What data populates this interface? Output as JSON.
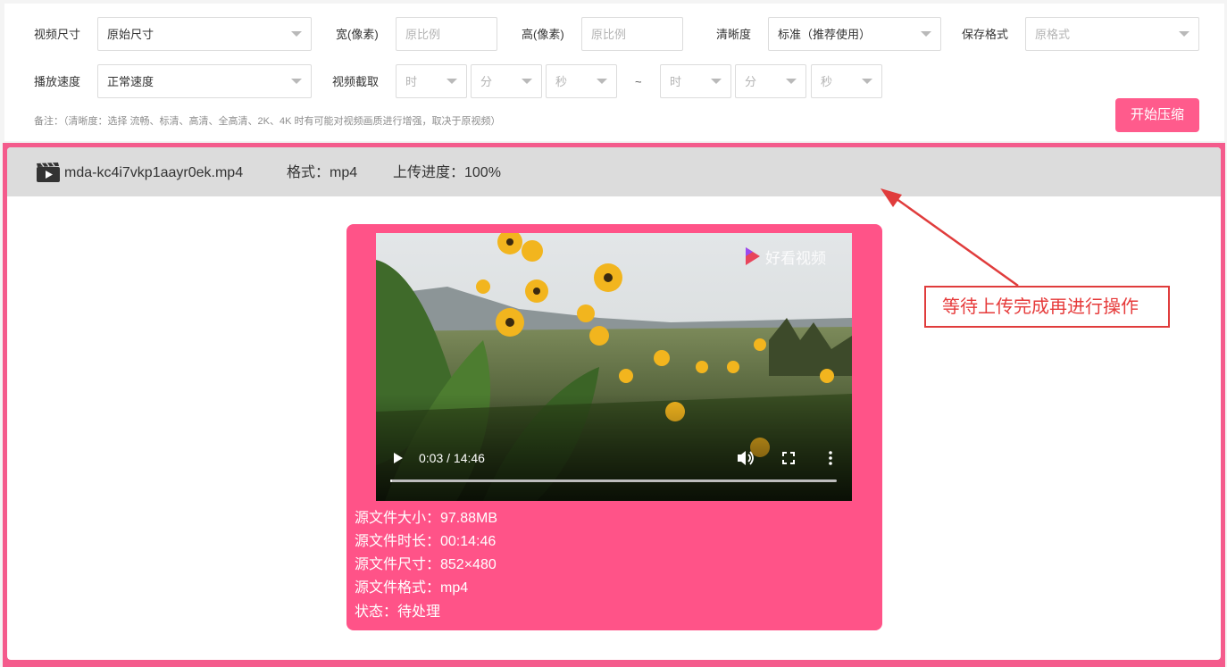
{
  "settings": {
    "video_size_label": "视频尺寸",
    "video_size_value": "原始尺寸",
    "width_label": "宽(像素)",
    "width_placeholder": "原比例",
    "height_label": "高(像素)",
    "height_placeholder": "原比例",
    "clarity_label": "清晰度",
    "clarity_value": "标准（推荐使用）",
    "format_label": "保存格式",
    "format_placeholder": "原格式",
    "speed_label": "播放速度",
    "speed_value": "正常速度",
    "clip_label": "视频截取",
    "clip_start": {
      "hour": "时",
      "minute": "分",
      "second": "秒"
    },
    "clip_separator": "~",
    "clip_end": {
      "hour": "时",
      "minute": "分",
      "second": "秒"
    },
    "note": "备注：（清晰度：选择 流畅、标清、高清、全高清、2K、4K 时有可能对视频画质进行增强，取决于原视频）",
    "start_button": "开始压缩"
  },
  "file": {
    "icon": "film-clapper-icon",
    "name": "mda-kc4i7vkp1aayr0ek.mp4",
    "format_text": "格式：mp4",
    "progress_text": "上传进度：100%",
    "upload_progress_percent": 100
  },
  "player": {
    "watermark": "好看视频",
    "time": "0:03 / 14:46",
    "progress_fraction": 0.0034,
    "icons": [
      "play-icon",
      "volume-icon",
      "fullscreen-icon",
      "more-options-icon"
    ]
  },
  "file_info": {
    "size": "源文件大小：97.88MB",
    "duration": "源文件时长：00:14:46",
    "dimensions": "源文件尺寸：852×480",
    "format": "源文件格式：mp4",
    "status": "状态：待处理"
  },
  "annotation": "等待上传完成再进行操作",
  "colors": {
    "accent_pink": "#ff5b8c",
    "card_pink": "#ff5388",
    "annotation_red": "#e03c3c",
    "filebar_gray": "#dcdcdc"
  }
}
